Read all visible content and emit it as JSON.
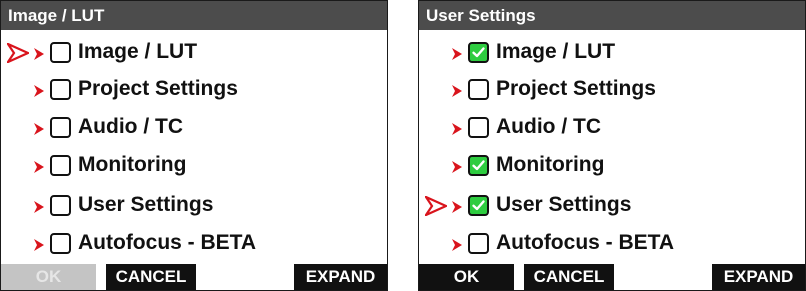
{
  "colors": {
    "titlebar_bg": "#4c4c4c",
    "check_green": "#2ecc40",
    "pointer_red": "#d9141c",
    "disabled_btn": "#c4c4c4"
  },
  "panels": [
    {
      "title": "Image / LUT",
      "selected_index": 0,
      "items": [
        {
          "label": "Image / LUT",
          "checked": false
        },
        {
          "label": "Project Settings",
          "checked": false
        },
        {
          "label": "Audio / TC",
          "checked": false
        },
        {
          "label": "Monitoring",
          "checked": false
        },
        {
          "label": "User Settings",
          "checked": false
        },
        {
          "label": "Autofocus - BETA",
          "checked": false
        }
      ],
      "buttons": {
        "ok": "OK",
        "ok_disabled": true,
        "cancel": "CANCEL",
        "expand": "EXPAND"
      }
    },
    {
      "title": "User Settings",
      "selected_index": 4,
      "items": [
        {
          "label": "Image / LUT",
          "checked": true
        },
        {
          "label": "Project Settings",
          "checked": false
        },
        {
          "label": "Audio / TC",
          "checked": false
        },
        {
          "label": "Monitoring",
          "checked": true
        },
        {
          "label": "User Settings",
          "checked": true
        },
        {
          "label": "Autofocus - BETA",
          "checked": false
        }
      ],
      "buttons": {
        "ok": "OK",
        "ok_disabled": false,
        "cancel": "CANCEL",
        "expand": "EXPAND"
      }
    }
  ]
}
